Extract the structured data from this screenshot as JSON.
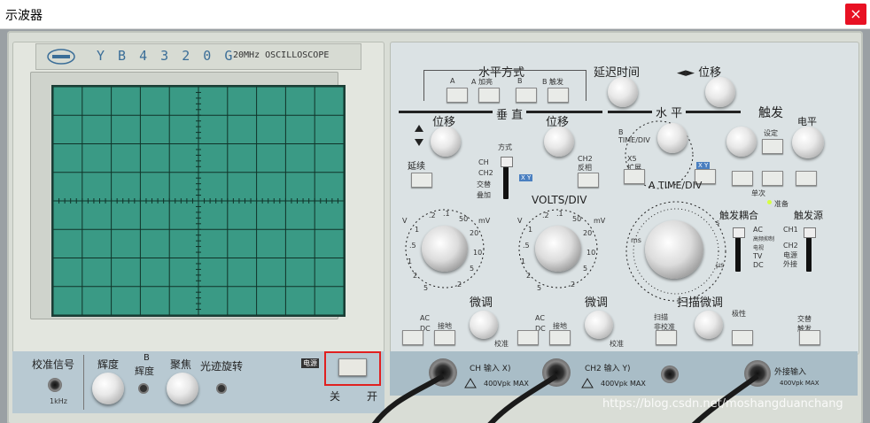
{
  "window": {
    "title": "示波器",
    "close_glyph": "×"
  },
  "brand": {
    "model": "Y B 4 3 2 0 G",
    "spec": "20MHz   OSCILLOSCOPE"
  },
  "bottom_left": {
    "calibration_label": "校准信号",
    "calibration_freq": "1kHz",
    "intensity_label": "辉度",
    "b_label": "B",
    "b_intensity_label": "辉度",
    "focus_label": "聚焦",
    "trace_rotation_label": "光迹旋转",
    "power_badge": "电源",
    "power_off_label": "关",
    "power_on_label": "开"
  },
  "horizontal_mode": {
    "title": "水平方式",
    "buttons": [
      "A",
      "A 加亮",
      "B",
      "B 触发"
    ]
  },
  "delay": {
    "label": "延迟时间"
  },
  "h_position": {
    "label": "◄► 位移"
  },
  "vertical": {
    "title": "垂 直",
    "ch1_position": "位移",
    "ch2_position": "位移",
    "alt_label": "延续",
    "mode_label": "方式",
    "mode_options": [
      "CH",
      "CH2",
      "交替",
      "叠加"
    ],
    "xy_badge": "X Y",
    "ch2_invert": "CH2 反相",
    "volts_div": "VOLTS/DIV",
    "fine_left": "微调",
    "fine_right": "微调",
    "calib_left": "校准",
    "calib_right": "校准",
    "coupling_left": [
      "AC",
      "DC"
    ],
    "coupling_right": [
      "AC",
      "DC"
    ],
    "gnd_left": "接地",
    "gnd_right": "接地",
    "unit_v": "V",
    "unit_mv": "mV",
    "scale_left": [
      ".2",
      ".1",
      "50",
      "20",
      "10",
      "5",
      "2",
      "1",
      ".5",
      "1",
      "2",
      "5"
    ],
    "scale_right": [
      ".2",
      ".1",
      "50",
      "20",
      "10",
      "5",
      "2",
      "1",
      ".5",
      "1",
      "2",
      "5"
    ]
  },
  "horizontal": {
    "title": "水 平",
    "b_time": "B TIME/DIV",
    "x5": "X5 扩展",
    "a_time": "A TIME/DIV",
    "sweep_fine": "扫描微调",
    "sweep_uncal": "扫描 非校准",
    "time_units": [
      "ms",
      "s",
      "μs"
    ]
  },
  "trigger": {
    "title": "触发",
    "set_label": "设定",
    "level_label": "电平",
    "single": "单次",
    "ready": "准备",
    "coupling_title": "触发耦合",
    "coupling_options": [
      "AC",
      "高频抑制",
      "电视",
      "TV",
      "DC"
    ],
    "source_title": "触发源",
    "source_options": [
      "CH1",
      "CH2",
      "电源",
      "外接"
    ],
    "polarity": "极性",
    "alt_trigger": "交替触发"
  },
  "inputs": {
    "ch1": "CH 输入 X)",
    "ch1_limit": "400Vpk MAX",
    "ch2": "CH2 输入 Y)",
    "ch2_limit": "400Vpk MAX",
    "ext": "外接输入",
    "ext_limit": "400Vpk MAX"
  },
  "watermark": "https://blog.csdn.net/moshangduanchang",
  "colors": {
    "screen": "#3a9a85",
    "close": "#e81123",
    "highlight": "#e02020"
  }
}
